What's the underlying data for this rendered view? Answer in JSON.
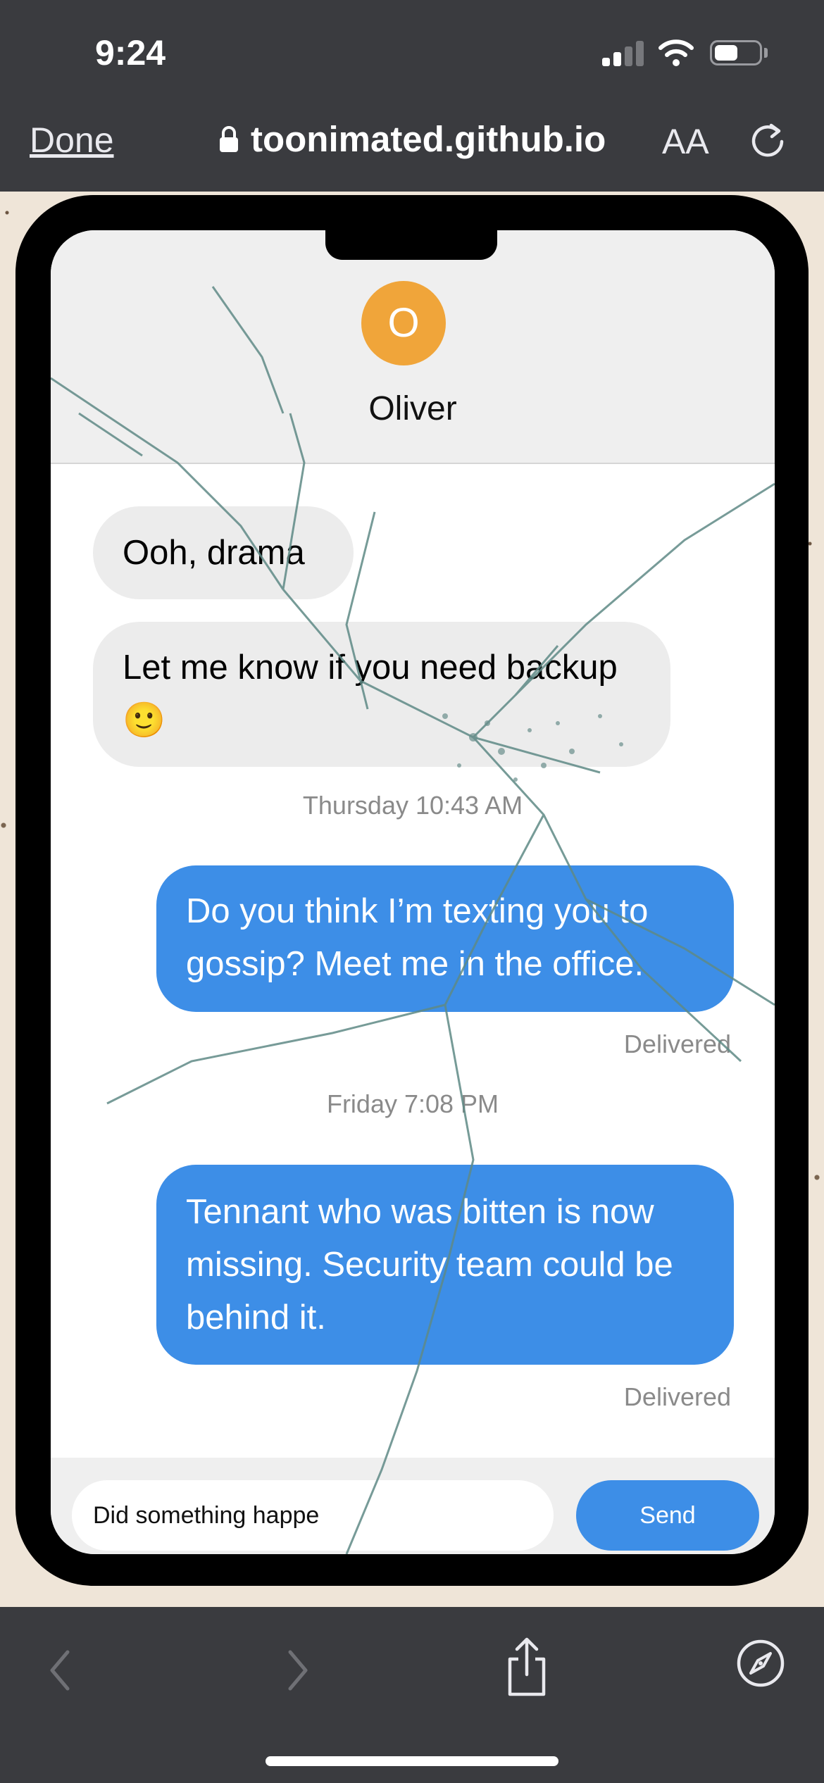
{
  "status_bar": {
    "time": "9:24"
  },
  "browser": {
    "done_label": "Done",
    "url": "toonimated.github.io",
    "text_size_label": "AA"
  },
  "chat": {
    "contact_initial": "O",
    "contact_name": "Oliver",
    "avatar_color": "#f0a53a",
    "messages": [
      {
        "direction": "incoming",
        "text": "Ooh, drama"
      },
      {
        "direction": "incoming",
        "text": "Let me know if you need backup 🙂"
      },
      {
        "timestamp": "Thursday 10:43 AM"
      },
      {
        "direction": "outgoing",
        "text": "Do you think I’m texting you to gossip? Meet me in the office.",
        "status": "Delivered"
      },
      {
        "timestamp": "Friday 7:08 PM"
      },
      {
        "direction": "outgoing",
        "text": "Tennant who was bitten is now missing. Security team could be behind it.",
        "status": "Delivered"
      }
    ],
    "input_value": "Did something happe",
    "send_label": "Send",
    "outgoing_color": "#3d8ee7",
    "incoming_color": "#ececec"
  },
  "toolbar": {
    "icons": [
      "back-icon",
      "forward-icon",
      "share-icon",
      "compass-icon"
    ]
  }
}
